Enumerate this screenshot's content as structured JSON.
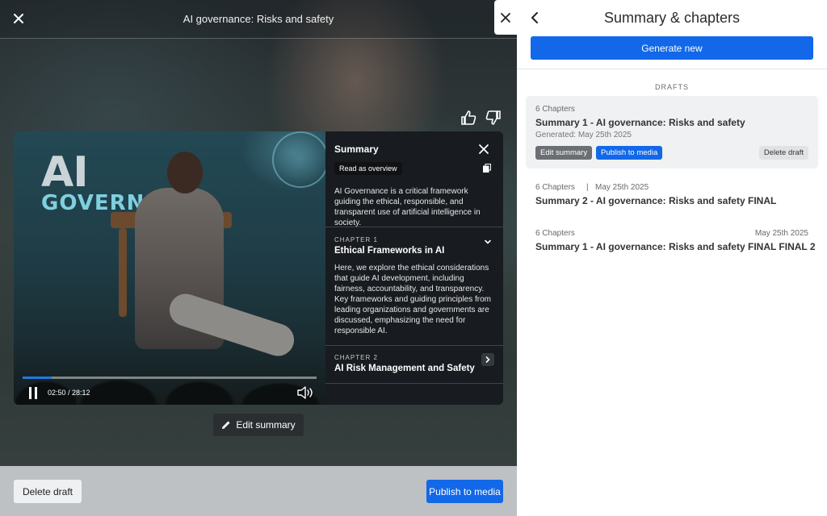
{
  "player": {
    "title": "AI governance: Risks and safety",
    "time": "02:50 / 28:12",
    "progress_fraction": 0.1,
    "stage_text": {
      "line1": "AI",
      "line2": "GOVERN"
    }
  },
  "summary_panel": {
    "heading": "Summary",
    "overview_button": "Read as overview",
    "text": "AI Governance is a critical framework guiding the ethical, responsible, and transparent use of artificial intelligence in society.",
    "chapters": [
      {
        "label": "CHAPTER 1",
        "title": "Ethical Frameworks in AI",
        "text": "Here, we explore the ethical considerations that guide AI development, including fairness, accountability, and transparency. Key frameworks and guiding principles from leading organizations and governments are discussed, emphasizing the need for responsible AI."
      },
      {
        "label": "CHAPTER 2",
        "title": "AI Risk Management and Safety"
      }
    ]
  },
  "actions": {
    "edit_summary": "Edit summary",
    "delete_draft": "Delete draft",
    "publish": "Publish to media"
  },
  "side_panel": {
    "title": "Summary & chapters",
    "generate_button": "Generate new",
    "drafts_label": "DRAFTS",
    "drafts": [
      {
        "chapters": "6 Chapters",
        "title": "Summary 1 - AI governance: Risks and safety",
        "generated": "Generated: May 25th 2025",
        "edit_label": "Edit summary",
        "publish_label": "Publish to media",
        "delete_label": "Delete draft"
      },
      {
        "chapters": "6 Chapters",
        "separator": "|",
        "date": "May 25th 2025",
        "title": "Summary 2 - AI governance: Risks and safety FINAL"
      },
      {
        "chapters": "6 Chapters",
        "date": "May 25th 2025",
        "title": "Summary 1 - AI governance: Risks and safety FINAL FINAL 2"
      }
    ]
  },
  "colors": {
    "accent": "#1268e8",
    "panel_bg": "#ffffff",
    "active_draft_bg": "#eff1f3"
  },
  "icons": [
    "close-icon",
    "thumbs-up-icon",
    "thumbs-down-icon",
    "pause-icon",
    "volume-icon",
    "copy-icon",
    "chevron-down-icon",
    "chevron-right-icon",
    "pencil-icon",
    "back-chevron-icon"
  ]
}
